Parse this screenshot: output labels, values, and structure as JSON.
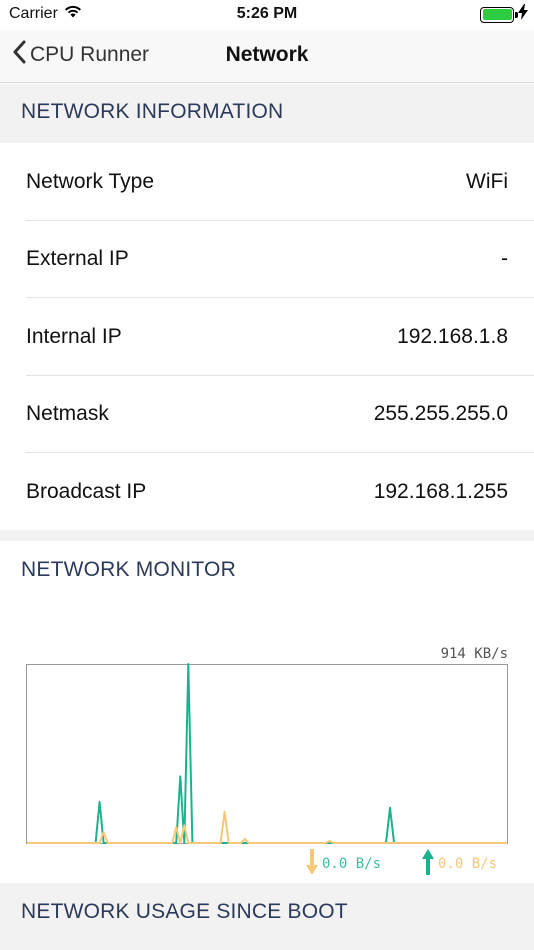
{
  "status_bar": {
    "carrier": "Carrier",
    "time": "5:26 PM",
    "battery_level": 1.0
  },
  "nav": {
    "back_label": "CPU Runner",
    "title": "Network"
  },
  "network_information": {
    "header": "NETWORK INFORMATION",
    "rows": [
      {
        "label": "Network Type",
        "value": "WiFi"
      },
      {
        "label": "External IP",
        "value": "-"
      },
      {
        "label": "Internal IP",
        "value": "192.168.1.8"
      },
      {
        "label": "Netmask",
        "value": "255.255.255.0"
      },
      {
        "label": "Broadcast IP",
        "value": "192.168.1.255"
      }
    ]
  },
  "network_monitor": {
    "header": "NETWORK MONITOR",
    "max_label": "914 KB/s",
    "download_rate": "0.0 B/s",
    "upload_rate": "0.0 B/s",
    "colors": {
      "download": "#1bb38f",
      "upload": "#f7c77a",
      "arrow_down": "#f7c77a",
      "arrow_up": "#1bb38f"
    }
  },
  "network_usage": {
    "header": "NETWORK USAGE SINCE BOOT"
  },
  "chart_data": {
    "type": "line",
    "ylim": [
      0,
      914
    ],
    "series": [
      {
        "color": "#1bb38f",
        "values": [
          0,
          0,
          0,
          0,
          0,
          0,
          0,
          0,
          0,
          0,
          0,
          0,
          0,
          0,
          0,
          0,
          0,
          0,
          0,
          0,
          0,
          0,
          0,
          0,
          0,
          0,
          0,
          0,
          0,
          0,
          0,
          0,
          0,
          0,
          0,
          0,
          0,
          0,
          0,
          0,
          0,
          0,
          0,
          0,
          0,
          0,
          0,
          0,
          0,
          0,
          0,
          0,
          0,
          0,
          0,
          0,
          0,
          0,
          0,
          0,
          0,
          0,
          0,
          0,
          0,
          0,
          0,
          0,
          0,
          0,
          0,
          0,
          0,
          0,
          0,
          0,
          0,
          0,
          0,
          0,
          0,
          0,
          0,
          0,
          0,
          0,
          0,
          0,
          0,
          0,
          0,
          0,
          0,
          0,
          0,
          0,
          0,
          0,
          0,
          0,
          0,
          0,
          0,
          0,
          0,
          0,
          0,
          0,
          0,
          0,
          0,
          0,
          0,
          0,
          0,
          0,
          0,
          0,
          0,
          0
        ]
      },
      {
        "color": "#f7c77a",
        "values": [
          0,
          0,
          0,
          0,
          0,
          0,
          0,
          0,
          0,
          0,
          0,
          0,
          0,
          0,
          0,
          0,
          0,
          0,
          0,
          0,
          0,
          0,
          0,
          0,
          0,
          0,
          0,
          0,
          0,
          0,
          0,
          0,
          0,
          0,
          0,
          0,
          0,
          0,
          0,
          0,
          0,
          0,
          0,
          0,
          0,
          0,
          0,
          0,
          0,
          0,
          0,
          0,
          0,
          0,
          0,
          0,
          0,
          0,
          0,
          0,
          0,
          0,
          0,
          0,
          0,
          0,
          0,
          0,
          0,
          0,
          0,
          0,
          0,
          0,
          0,
          0,
          0,
          0,
          0,
          0,
          0,
          0,
          0,
          0,
          0,
          0,
          0,
          0,
          0,
          0,
          0,
          0,
          0,
          0,
          0,
          0,
          0,
          0,
          0,
          0,
          0,
          0,
          0,
          0,
          0,
          0,
          0,
          0,
          0,
          0,
          0,
          0,
          0,
          0,
          0,
          0,
          0,
          0,
          0,
          0
        ]
      }
    ],
    "peaks": {
      "series0": [
        [
          18,
          210
        ],
        [
          38,
          340
        ],
        [
          40,
          914
        ],
        [
          90,
          180
        ],
        [
          4,
          0
        ]
      ],
      "series1": [
        [
          19,
          55
        ],
        [
          37,
          80
        ],
        [
          39,
          90
        ],
        [
          49,
          160
        ],
        [
          54,
          20
        ],
        [
          75,
          10
        ]
      ]
    }
  }
}
